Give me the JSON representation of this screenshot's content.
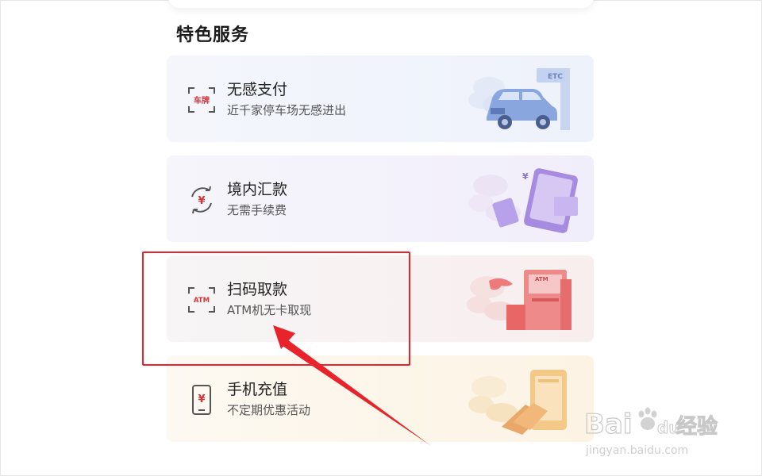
{
  "section": {
    "title": "特色服务"
  },
  "services": [
    {
      "title": "无感支付",
      "subtitle": "近千家停车场无感进出",
      "icon": "license-plate-scan-icon",
      "icon_text": "车牌",
      "illustration_text": "ETC"
    },
    {
      "title": "境内汇款",
      "subtitle": "无需手续费",
      "icon": "yuan-transfer-icon",
      "icon_text": "¥"
    },
    {
      "title": "扫码取款",
      "subtitle": "ATM机无卡取现",
      "icon": "atm-scan-icon",
      "icon_text": "ATM",
      "illustration_text": "ATM"
    },
    {
      "title": "手机充值",
      "subtitle": "不定期优惠活动",
      "icon": "phone-yuan-icon",
      "icon_text": "¥"
    }
  ],
  "annotation": {
    "highlight_color": "#e8232b"
  },
  "watermark": {
    "brand": "Bai",
    "brand_du": "du",
    "cn": "经验",
    "url": "jingyan.baidu.com"
  },
  "colors": {
    "accent_red": "#d6343a",
    "icon_gray": "#555555"
  }
}
